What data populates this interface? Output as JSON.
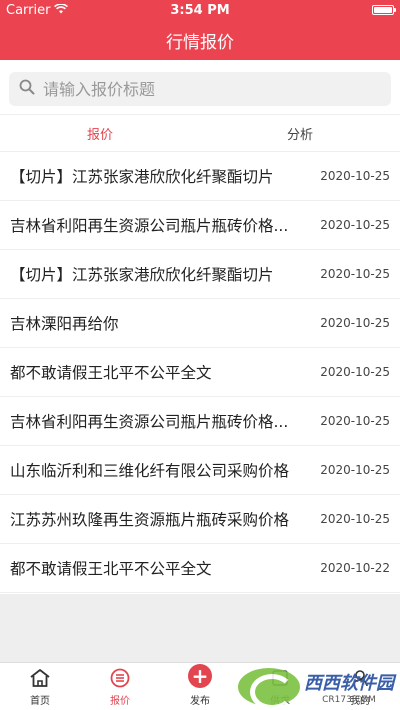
{
  "status_bar": {
    "carrier": "Carrier",
    "time": "3:54 PM",
    "battery_level": 1.0
  },
  "nav": {
    "title": "行情报价"
  },
  "search": {
    "placeholder": "请输入报价标题"
  },
  "tabs": [
    {
      "label": "报价",
      "active": true
    },
    {
      "label": "分析",
      "active": false
    }
  ],
  "list": [
    {
      "title": "【切片】江苏张家港欣欣化纤聚酯切片",
      "date": "2020-10-25"
    },
    {
      "title": "吉林省利阳再生资源公司瓶片瓶砖价格...",
      "date": "2020-10-25"
    },
    {
      "title": "【切片】江苏张家港欣欣化纤聚酯切片",
      "date": "2020-10-25"
    },
    {
      "title": "吉林溧阳再给你",
      "date": "2020-10-25"
    },
    {
      "title": "都不敢请假王北平不公平全文",
      "date": "2020-10-25"
    },
    {
      "title": "吉林省利阳再生资源公司瓶片瓶砖价格...",
      "date": "2020-10-25"
    },
    {
      "title": "山东临沂利和三维化纤有限公司采购价格",
      "date": "2020-10-25"
    },
    {
      "title": "江苏苏州玖隆再生资源瓶片瓶砖采购价格",
      "date": "2020-10-25"
    },
    {
      "title": "都不敢请假王北平不公平全文",
      "date": "2020-10-22"
    }
  ],
  "tabbar": [
    {
      "label": "首页",
      "icon": "home-icon",
      "active": false
    },
    {
      "label": "报价",
      "icon": "quote-list-icon",
      "active": true
    },
    {
      "label": "发布",
      "icon": "publish-plus-icon",
      "active": false
    },
    {
      "label": "供求",
      "icon": "supply-demand-icon",
      "active": false
    },
    {
      "label": "我的",
      "icon": "profile-icon",
      "active": false
    }
  ],
  "watermark": {
    "brand": "西西软件园",
    "site": "CR173.COM"
  },
  "colors": {
    "accent": "#eb4450",
    "active_text": "#e2454f",
    "background_grey": "#eeeeee"
  }
}
